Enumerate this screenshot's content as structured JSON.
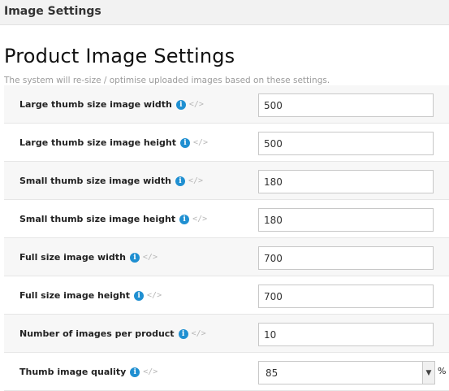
{
  "header": {
    "title": "Image Settings"
  },
  "page": {
    "title": "Product Image Settings",
    "subtitle": "The system will re-size / optimise uploaded images based on these settings."
  },
  "icons": {
    "info": "info-icon",
    "code": "code-icon",
    "info_glyph": "i",
    "code_glyph": "</>"
  },
  "colors": {
    "info_icon": "#1f8fd1",
    "row_alt": "#f7f7f7"
  },
  "settings": [
    {
      "label": "Large thumb size image width",
      "value": "500"
    },
    {
      "label": "Large thumb size image height",
      "value": "500"
    },
    {
      "label": "Small thumb size image width",
      "value": "180"
    },
    {
      "label": "Small thumb size image height",
      "value": "180"
    },
    {
      "label": "Full size image width",
      "value": "700"
    },
    {
      "label": "Full size image height",
      "value": "700"
    },
    {
      "label": "Number of images per product",
      "value": "10"
    },
    {
      "label": "Thumb image quality",
      "value": "85",
      "unit": "%"
    }
  ]
}
